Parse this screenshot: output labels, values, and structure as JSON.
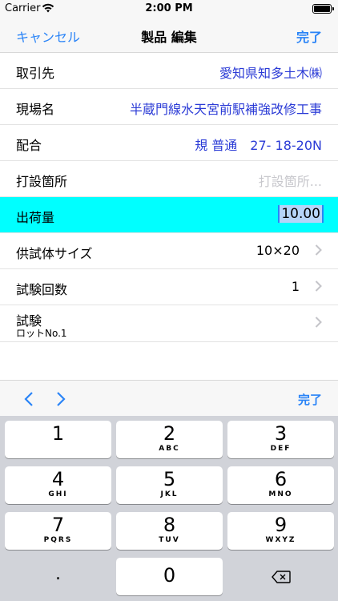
{
  "status": {
    "carrier": "Carrier",
    "time": "2:00 PM"
  },
  "nav": {
    "cancel": "キャンセル",
    "title": "製品 編集",
    "done": "完了"
  },
  "rows": [
    {
      "label": "取引先",
      "value": "愛知県知多土木㈱"
    },
    {
      "label": "現場名",
      "value": "半蔵門線水天宮前駅補強改修工事"
    },
    {
      "label": "配合",
      "value": "規 普通　27- 18-20N"
    },
    {
      "label": "打設箇所",
      "placeholder": "打設箇所..."
    },
    {
      "label": "出荷量",
      "value": "10.00"
    },
    {
      "label": "供試体サイズ",
      "value": "10×20"
    },
    {
      "label": "試験回数",
      "value": "1"
    },
    {
      "label": "試験",
      "sublabel": "ロットNo.1"
    }
  ],
  "toolbar": {
    "done": "完了"
  },
  "keypad": [
    {
      "num": "1",
      "letters": ""
    },
    {
      "num": "2",
      "letters": "ABC"
    },
    {
      "num": "3",
      "letters": "DEF"
    },
    {
      "num": "4",
      "letters": "GHI"
    },
    {
      "num": "5",
      "letters": "JKL"
    },
    {
      "num": "6",
      "letters": "MNO"
    },
    {
      "num": "7",
      "letters": "PQRS"
    },
    {
      "num": "8",
      "letters": "TUV"
    },
    {
      "num": "9",
      "letters": "WXYZ"
    },
    {
      "num": ".",
      "letters": ""
    },
    {
      "num": "0",
      "letters": ""
    }
  ],
  "colors": {
    "accent": "#2a84f7",
    "value_text": "#2b3bd6",
    "highlight": "#00ffff"
  }
}
